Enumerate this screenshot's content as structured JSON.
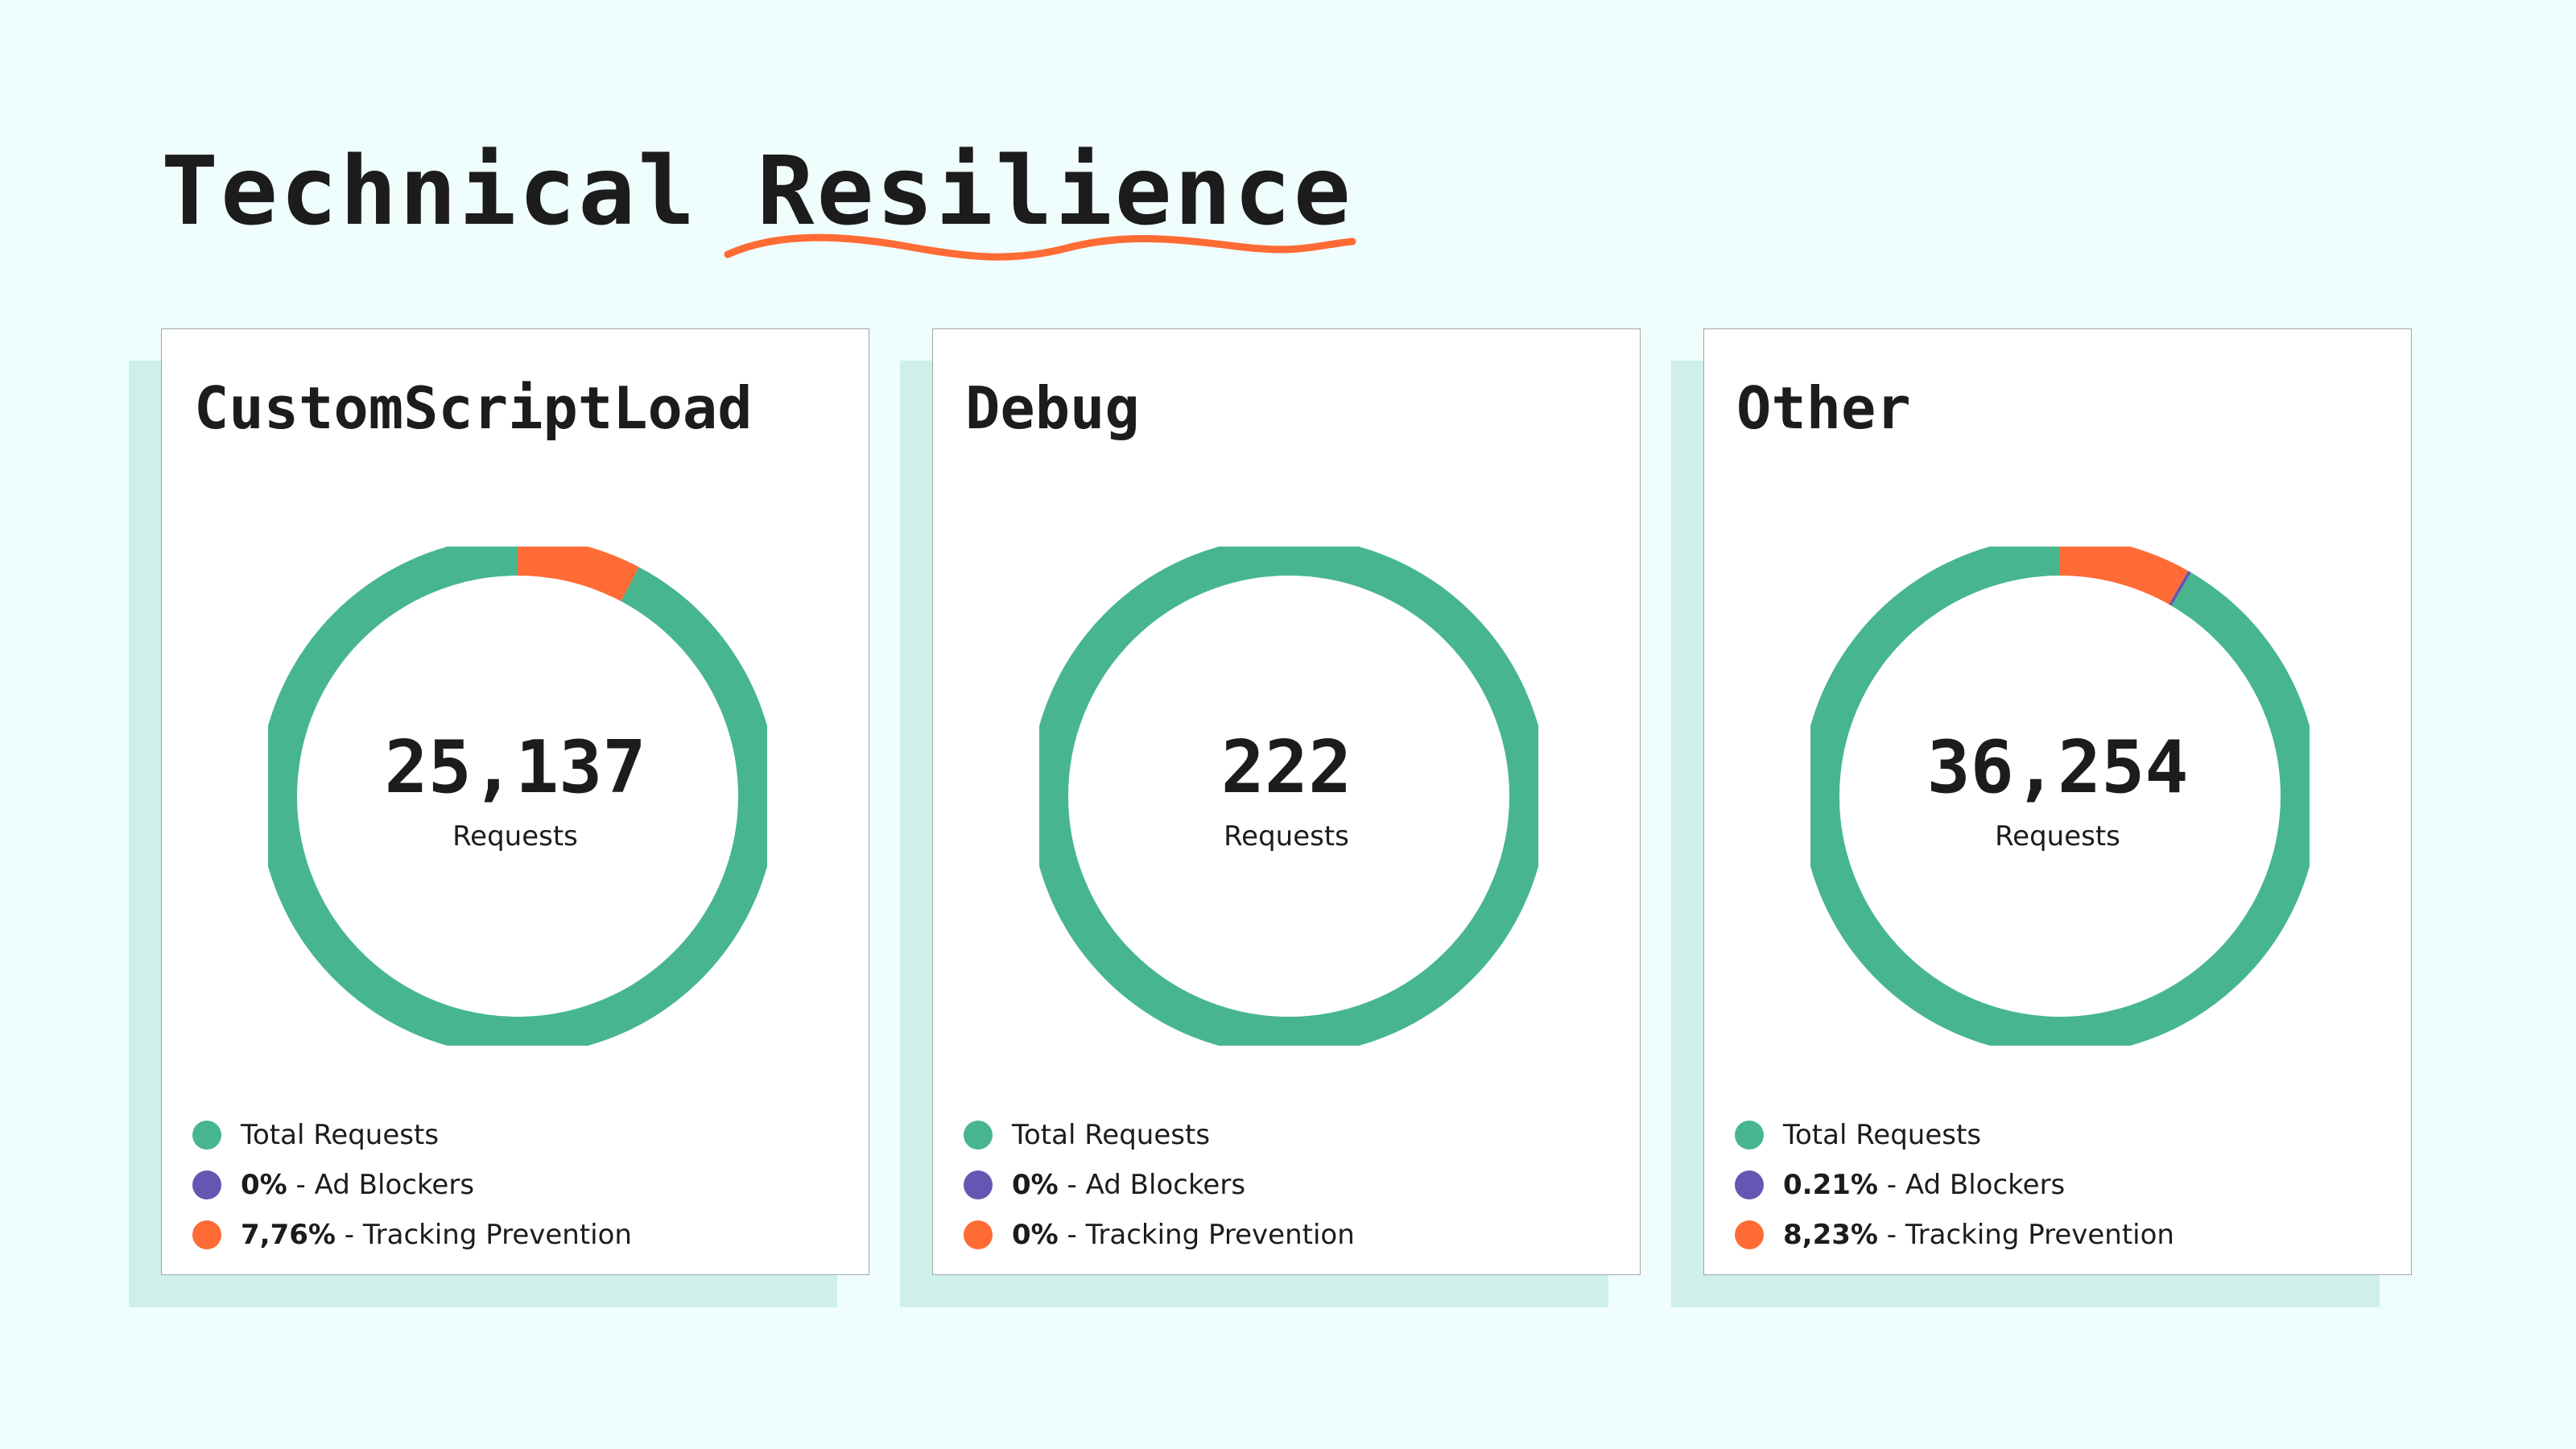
{
  "page": {
    "title": "Technical Resilience"
  },
  "colors": {
    "background": "#effefd",
    "total": "#47b68e",
    "ad_blockers": "#6655b2",
    "tracking": "#ff6b35",
    "underline": "#ff6b35",
    "card_shadow": "#cfefea"
  },
  "chart_data": [
    {
      "type": "pie",
      "title": "CustomScriptLoad",
      "center_value": "25,137",
      "center_label": "Requests",
      "slices": [
        {
          "name": "Total Requests",
          "color": "#47b68e",
          "value": 92.24
        },
        {
          "name": "Ad Blockers",
          "color": "#6655b2",
          "value": 0
        },
        {
          "name": "Tracking Prevention",
          "color": "#ff6b35",
          "value": 7.76
        }
      ],
      "legend": [
        {
          "label": "Total Requests",
          "value": "",
          "sep": "",
          "color": "#47b68e"
        },
        {
          "label": "Ad Blockers",
          "value": "0%",
          "sep": " - ",
          "color": "#6655b2"
        },
        {
          "label": "Tracking Prevention",
          "value": "7,76%",
          "sep": " - ",
          "color": "#ff6b35"
        }
      ]
    },
    {
      "type": "pie",
      "title": "Debug",
      "center_value": "222",
      "center_label": "Requests",
      "slices": [
        {
          "name": "Total Requests",
          "color": "#47b68e",
          "value": 100
        },
        {
          "name": "Ad Blockers",
          "color": "#6655b2",
          "value": 0
        },
        {
          "name": "Tracking Prevention",
          "color": "#ff6b35",
          "value": 0
        }
      ],
      "legend": [
        {
          "label": "Total Requests",
          "value": "",
          "sep": "",
          "color": "#47b68e"
        },
        {
          "label": "Ad Blockers",
          "value": "0%",
          "sep": " - ",
          "color": "#6655b2"
        },
        {
          "label": "Tracking Prevention",
          "value": "0%",
          "sep": " - ",
          "color": "#ff6b35"
        }
      ]
    },
    {
      "type": "pie",
      "title": "Other",
      "center_value": "36,254",
      "center_label": "Requests",
      "slices": [
        {
          "name": "Total Requests",
          "color": "#47b68e",
          "value": 91.56
        },
        {
          "name": "Ad Blockers",
          "color": "#6655b2",
          "value": 0.21
        },
        {
          "name": "Tracking Prevention",
          "color": "#ff6b35",
          "value": 8.23
        }
      ],
      "legend": [
        {
          "label": "Total Requests",
          "value": "",
          "sep": "",
          "color": "#47b68e"
        },
        {
          "label": "Ad Blockers",
          "value": "0.21%",
          "sep": " - ",
          "color": "#6655b2"
        },
        {
          "label": "Tracking Prevention",
          "value": "8,23%",
          "sep": " - ",
          "color": "#ff6b35"
        }
      ]
    }
  ]
}
